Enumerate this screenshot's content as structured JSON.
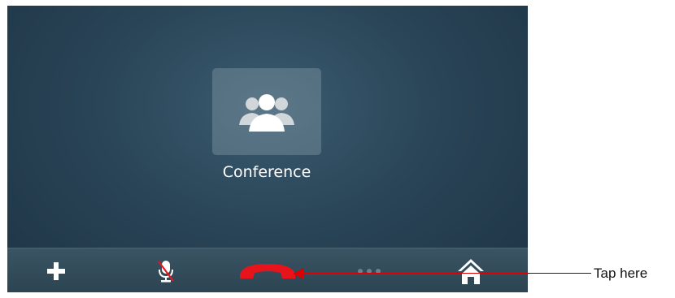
{
  "call": {
    "contact_name": "Conference",
    "contact_icon": "group-icon"
  },
  "toolbar": {
    "buttons": [
      {
        "id": "add",
        "icon": "plus-icon"
      },
      {
        "id": "mute",
        "icon": "microphone-muted-icon"
      },
      {
        "id": "end_call",
        "icon": "hang-up-icon",
        "color": "#e8141b"
      },
      {
        "id": "more",
        "icon": "more-dots-icon"
      },
      {
        "id": "home",
        "icon": "home-icon"
      }
    ]
  },
  "annotation": {
    "label": "Tap here",
    "arrow_color": "#dd0000"
  },
  "colors": {
    "screen_background": "#2a4558",
    "toolbar_background": "#34505e",
    "end_call_red": "#e8141b",
    "icon_white": "#ffffff"
  }
}
